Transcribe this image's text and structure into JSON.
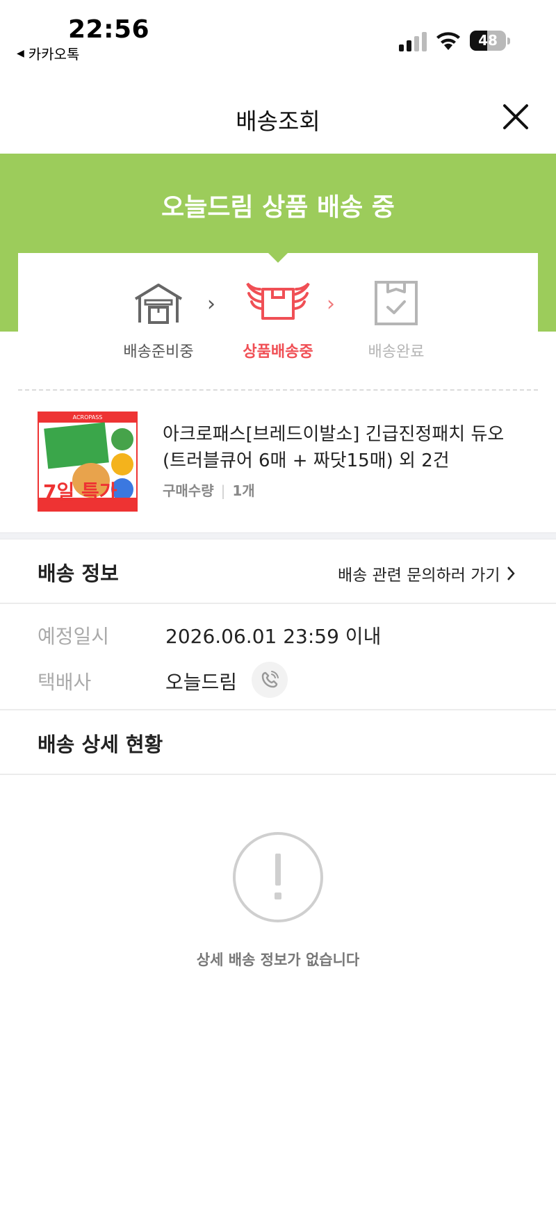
{
  "status_bar": {
    "time": "22:56",
    "back_app": "카카오톡",
    "battery": "48",
    "battery_level": 0.48
  },
  "header": {
    "title": "배송조회"
  },
  "banner": {
    "title": "오늘드림 상품 배송 중"
  },
  "steps": [
    {
      "label": "배송준비중",
      "state": "done"
    },
    {
      "label": "상품배송중",
      "state": "active"
    },
    {
      "label": "배송완료",
      "state": "pending"
    }
  ],
  "product": {
    "name": "아크로패스[브레드이발소] 긴급진정패치 듀오 (트러블큐어 6매 + 짜닷15매) 외 2건",
    "qty_label": "구매수량",
    "qty_value": "1개",
    "thumb_brand": "ACROPASS",
    "thumb_promo": "7일 특가"
  },
  "delivery_info": {
    "title": "배송 정보",
    "inquiry_link": "배송 관련 문의하러 가기",
    "rows": [
      {
        "label": "예정일시",
        "value": "2026.06.01 23:59 이내"
      },
      {
        "label": "택배사",
        "value": "오늘드림"
      }
    ]
  },
  "detail": {
    "title": "배송 상세 현황",
    "empty_text": "상세 배송 정보가 없습니다"
  },
  "colors": {
    "banner_green": "#9ccc5b",
    "active_red": "#f04f55",
    "muted_gray": "#b5b5b5"
  },
  "icons": {
    "close": "close-icon",
    "warehouse": "warehouse-icon",
    "winged_box": "winged-box-icon",
    "box_check": "box-check-icon",
    "phone": "phone-icon",
    "alert": "exclamation-circle-icon"
  }
}
